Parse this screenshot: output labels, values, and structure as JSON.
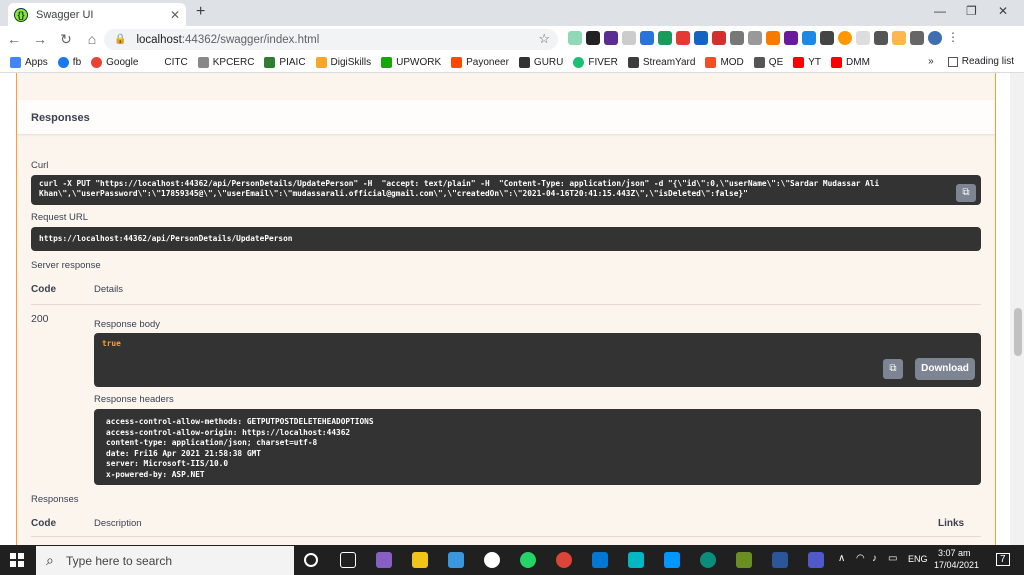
{
  "browser": {
    "tab_title": "Swagger UI",
    "url_host": "localhost",
    "url_path": ":44362/swagger/index.html",
    "bookmarks": [
      "Apps",
      "fb",
      "Google",
      "CITC",
      "KPCERC",
      "PIAIC",
      "DigiSkills",
      "UPWORK",
      "Payoneer",
      "GURU",
      "FIVER",
      "StreamYard",
      "MOD",
      "QE",
      "YT",
      "DMM"
    ],
    "reading_list": "Reading list"
  },
  "responses": {
    "section_title": "Responses",
    "curl_label": "Curl",
    "curl_command": "curl -X PUT \"https://localhost:44362/api/PersonDetails/UpdatePerson\" -H  \"accept: text/plain\" -H  \"Content-Type: application/json\" -d \"{\\\"id\\\":0,\\\"userName\\\":\\\"Sardar Mudassar Ali\nKhan\\\",\\\"userPassword\\\":\\\"17859345@\\\",\\\"userEmail\\\":\\\"mudassarali.official@gmail.com\\\",\\\"createdOn\\\":\\\"2021-04-16T20:41:15.443Z\\\",\\\"isDeleted\\\":false}\"",
    "request_url_label": "Request URL",
    "request_url": "https://localhost:44362/api/PersonDetails/UpdatePerson",
    "server_response_label": "Server response",
    "col_code": "Code",
    "col_details": "Details",
    "status_code": "200",
    "response_body_label": "Response body",
    "response_body": "true",
    "download_label": "Download",
    "response_headers_label": "Response headers",
    "response_headers": "access-control-allow-methods: GETPUTPOSTDELETEHEADOPTIONS\naccess-control-allow-origin: https://localhost:44362\ncontent-type: application/json; charset=utf-8\ndate: Fri16 Apr 2021 21:58:38 GMT\nserver: Microsoft-IIS/10.0\nx-powered-by: ASP.NET",
    "responses_label": "Responses",
    "col_description": "Description",
    "col_links": "Links"
  },
  "taskbar": {
    "search_placeholder": "Type here to search",
    "lang": "ENG",
    "time": "3:07 am",
    "date": "17/04/2021",
    "notifications": "7"
  },
  "colors": {
    "put_accent": "#fca130",
    "code_bg": "#333333"
  }
}
